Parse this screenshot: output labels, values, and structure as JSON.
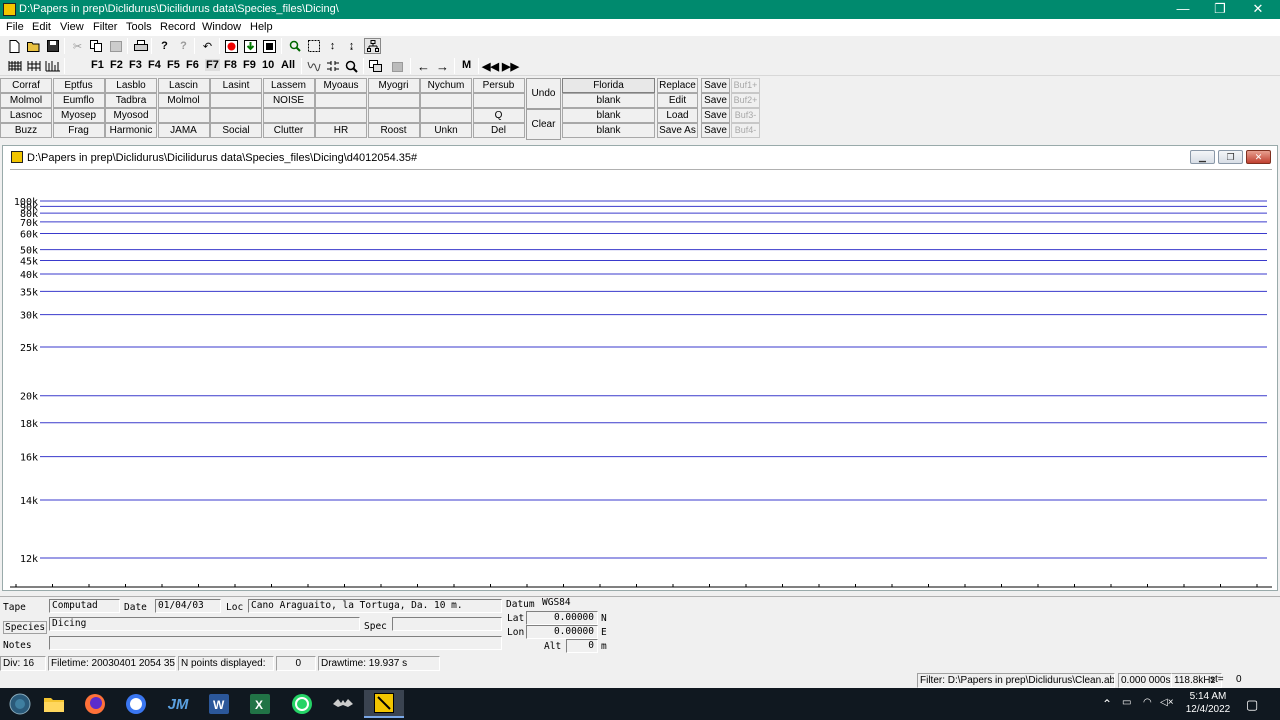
{
  "window": {
    "title": "D:\\Papers in prep\\Diclidurus\\Dicilidurus data\\Species_files\\Dicing\\",
    "minimize": "—",
    "maximize": "❐",
    "close": "✕"
  },
  "menu": [
    "File",
    "Edit",
    "View",
    "Filter",
    "Tools",
    "Record",
    "Window",
    "Help"
  ],
  "toolbar2": {
    "fkeys": [
      "F1",
      "F2",
      "F3",
      "F4",
      "F5",
      "F6",
      "F7",
      "F8",
      "F9",
      "10",
      "All"
    ],
    "m_label": "M"
  },
  "species_grid": [
    [
      "Corraf",
      "Eptfus",
      "Lasblo",
      "Lascin",
      "Lasint",
      "Lassem",
      "Myoaus",
      "Myogri",
      "Nychum",
      "Persub"
    ],
    [
      "Molmol",
      "Eumflo",
      "Tadbra",
      "Molmol",
      "",
      "NOISE",
      "",
      "",
      "",
      ""
    ],
    [
      "Lasnoc",
      "Myosep",
      "Myosod",
      "",
      "",
      "",
      "",
      "",
      "",
      "Q"
    ],
    [
      "Buzz",
      "Frag",
      "Harmonic",
      "JAMA",
      "Social",
      "Clutter",
      "HR",
      "Roost",
      "Unkn",
      "Del"
    ]
  ],
  "buttons": {
    "undo": "Undo",
    "clear": "Clear"
  },
  "file_slots": [
    "Florida",
    "blank",
    "blank",
    "blank"
  ],
  "file_actions": [
    "Replace",
    "Edit",
    "Load",
    "Save As"
  ],
  "save_buttons": [
    "Save",
    "Save",
    "Save",
    "Save"
  ],
  "buffers": [
    "Buf1+",
    "Buf2+",
    "Buf3-",
    "Buf4-"
  ],
  "child_window": {
    "title": "D:\\Papers in prep\\Diclidurus\\Dicilidurus data\\Species_files\\Dicing\\d4012054.35#"
  },
  "chart_data": {
    "type": "line",
    "ylabel": "",
    "y_scale": "reciprocal",
    "y_ticks": [
      {
        "label": "100k",
        "value": 100
      },
      {
        "label": "90k",
        "value": 90
      },
      {
        "label": "80k",
        "value": 80
      },
      {
        "label": "70k",
        "value": 70
      },
      {
        "label": "60k",
        "value": 60
      },
      {
        "label": "50k",
        "value": 50
      },
      {
        "label": "45k",
        "value": 45
      },
      {
        "label": "40k",
        "value": 40
      },
      {
        "label": "35k",
        "value": 35
      },
      {
        "label": "30k",
        "value": 30
      },
      {
        "label": "25k",
        "value": 25
      },
      {
        "label": "20k",
        "value": 20
      },
      {
        "label": "18k",
        "value": 18
      },
      {
        "label": "16k",
        "value": 16
      },
      {
        "label": "14k",
        "value": 14
      },
      {
        "label": "12k",
        "value": 12
      }
    ],
    "gridline_color": "#3a3acc",
    "grid": true,
    "n_points": 0
  },
  "info": {
    "tape_label": "Tape",
    "tape_value": "Computad",
    "date_label": "Date",
    "date_value": "01/04/03",
    "loc_label": "Loc",
    "loc_value": "Cano Araguaito, la Tortuga, Da. 10 m.",
    "datum_label": "Datum",
    "datum_value": "WGS84",
    "species_label": "Species",
    "species_value": "Dicing",
    "spec_label": "Spec",
    "spec_value": "",
    "lat_label": "Lat",
    "lat_value": "0.00000",
    "lat_dir": "N",
    "lon_label": "Lon",
    "lon_value": "0.00000",
    "lon_dir": "E",
    "notes_label": "Notes",
    "notes_value": "",
    "alt_label": "Alt",
    "alt_value": "0",
    "alt_unit": "m"
  },
  "status": {
    "div": "Div: 16",
    "filetime": "Filetime: 20030401 2054 35",
    "npoints_label": "N points displayed:",
    "npoints_value": "0",
    "drawtime": "Drawtime: 19.937 s"
  },
  "filter": {
    "path": "Filter: D:\\Papers in prep\\Diclidurus\\Clean.abf",
    "time": "0.000 000s",
    "freq": "118.8kHz",
    "st": "st=",
    "st_value": "0"
  },
  "taskbar": {
    "time": "5:14 AM",
    "date": "12/4/2022"
  }
}
